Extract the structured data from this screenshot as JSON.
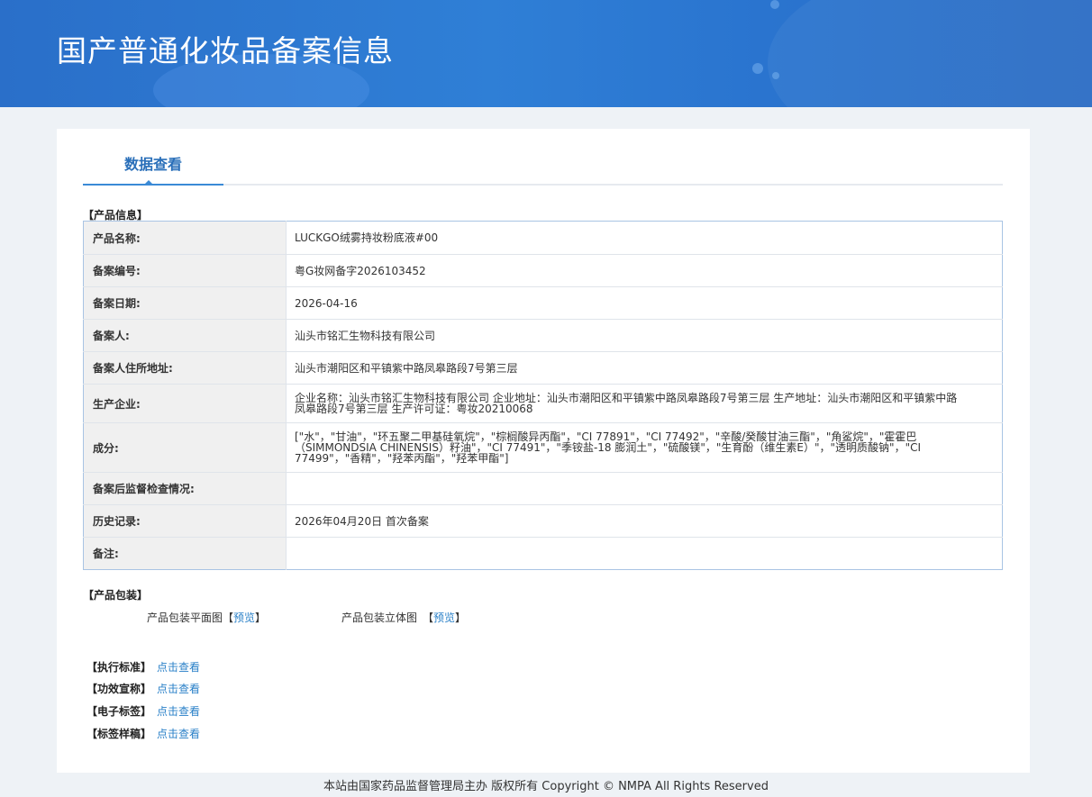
{
  "header": {
    "title": "国产普通化妆品备案信息"
  },
  "tabs": [
    {
      "label": "数据查看",
      "active": true
    }
  ],
  "product_info": {
    "section_title": "【产品信息】",
    "rows": [
      {
        "key": "产品名称:",
        "value": "LUCKGO绒雾持妆粉底液#00"
      },
      {
        "key": "备案编号:",
        "value": "粤G妆网备字2026103452"
      },
      {
        "key": "备案日期:",
        "value": "2026-04-16"
      },
      {
        "key": "备案人:",
        "value": "汕头市铭汇生物科技有限公司"
      },
      {
        "key": "备案人住所地址:",
        "value": "汕头市潮阳区和平镇紫中路凤皋路段7号第三层"
      },
      {
        "key": "生产企业:",
        "value": "企业名称：汕头市铭汇生物科技有限公司 企业地址：汕头市潮阳区和平镇紫中路凤皋路段7号第三层 生产地址：汕头市潮阳区和平镇紫中路凤皋路段7号第三层 生产许可证：粤妆20210068"
      },
      {
        "key": "成分:",
        "value": "[\"水\"，\"甘油\"，\"环五聚二甲基硅氧烷\"，\"棕榈酸异丙酯\"，\"CI 77891\"，\"CI 77492\"，\"辛酸/癸酸甘油三酯\"，\"角鲨烷\"，\"霍霍巴（SIMMONDSIA CHINENSIS）籽油\"，\"CI 77491\"，\"季铵盐-18 膨润土\"，\"硫酸镁\"，\"生育酚（维生素E）\"，\"透明质酸钠\"，\"CI 77499\"，\"香精\"，\"羟苯丙酯\"，\"羟苯甲酯\"]"
      },
      {
        "key": "备案后监督检查情况:",
        "value": ""
      },
      {
        "key": "历史记录:",
        "value": "2026年04月20日 首次备案"
      },
      {
        "key": "备注:",
        "value": ""
      }
    ]
  },
  "packaging": {
    "section_title": "【产品包装】",
    "flat_label": "产品包装平面图",
    "solid_label": "产品包装立体图",
    "preview_link": "预览",
    "bracket_open": "【",
    "bracket_close": "】"
  },
  "standards": [
    {
      "label": "【执行标准】",
      "link": "点击查看"
    },
    {
      "label": "【功效宣称】",
      "link": "点击查看"
    },
    {
      "label": "【电子标签】",
      "link": "点击查看"
    },
    {
      "label": "【标签样稿】",
      "link": "点击查看"
    }
  ],
  "footer": {
    "text": "本站由国家药品监督管理局主办 版权所有 Copyright © NMPA All Rights Reserved"
  },
  "colors": {
    "banner": "#2f7fd6",
    "tab_active": "#2a6fb9",
    "link": "#2a80c8",
    "table_border": "#a9c4e4"
  }
}
